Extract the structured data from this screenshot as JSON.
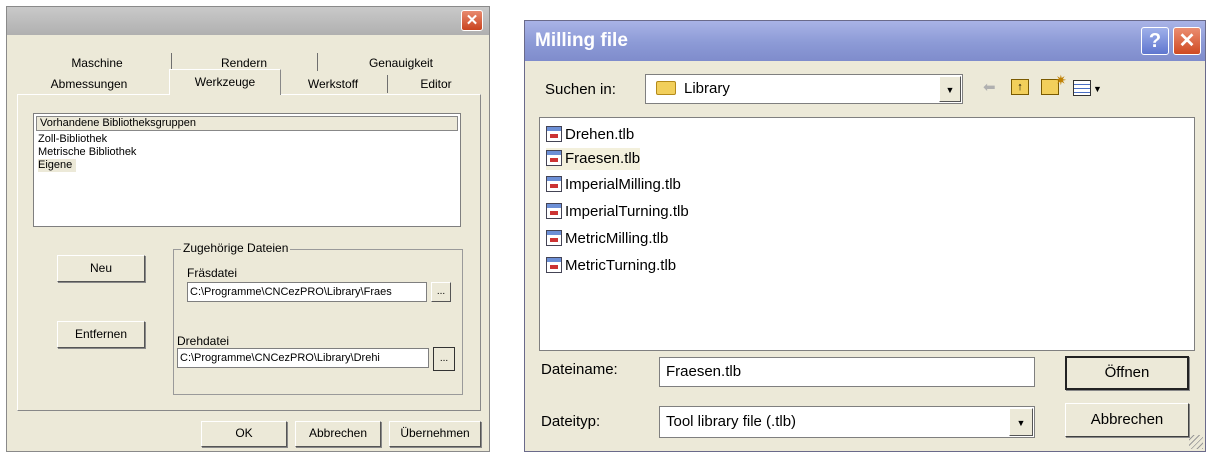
{
  "left_dialog": {
    "close_symbol": "✕",
    "tabs_row1": [
      "Maschine",
      "Rendern",
      "Genauigkeit"
    ],
    "tabs_row2": [
      "Abmessungen",
      "Werkzeuge",
      "Werkstoff",
      "Editor"
    ],
    "active_tab": "Werkzeuge",
    "list_header": "Vorhandene Bibliotheksgruppen",
    "list_items": [
      "Zoll-Bibliothek",
      "Metrische Bibliothek",
      "Eigene"
    ],
    "selected_item": "Eigene",
    "new_button": "Neu",
    "remove_button": "Entfernen",
    "group_label": "Zugehörige Dateien",
    "milling_label": "Fräsdatei",
    "milling_path": "C:\\Programme\\CNCezPRO\\Library\\Fraes",
    "turning_label": "Drehdatei",
    "turning_path": "C:\\Programme\\CNCezPRO\\Library\\Drehi",
    "browse_label": "...",
    "ok_button": "OK",
    "cancel_button": "Abbrechen",
    "apply_button": "Übernehmen"
  },
  "right_dialog": {
    "title": "Milling file",
    "help_symbol": "?",
    "close_symbol": "✕",
    "look_in_label": "Suchen in:",
    "look_in_value": "Library",
    "files": [
      "Drehen.tlb",
      "Fraesen.tlb",
      "ImperialMilling.tlb",
      "ImperialTurning.tlb",
      "MetricMilling.tlb",
      "MetricTurning.tlb"
    ],
    "selected_file": "Fraesen.tlb",
    "filename_label": "Dateiname:",
    "filename_value": "Fraesen.tlb",
    "filetype_label": "Dateityp:",
    "filetype_value": "Tool library file (.tlb)",
    "open_button": "Öffnen",
    "cancel_button": "Abbrechen"
  },
  "colors": {
    "dialog_bg": "#ece9d8",
    "titlebar_blue": "#8c9ad6",
    "close_red": "#c9441f"
  }
}
